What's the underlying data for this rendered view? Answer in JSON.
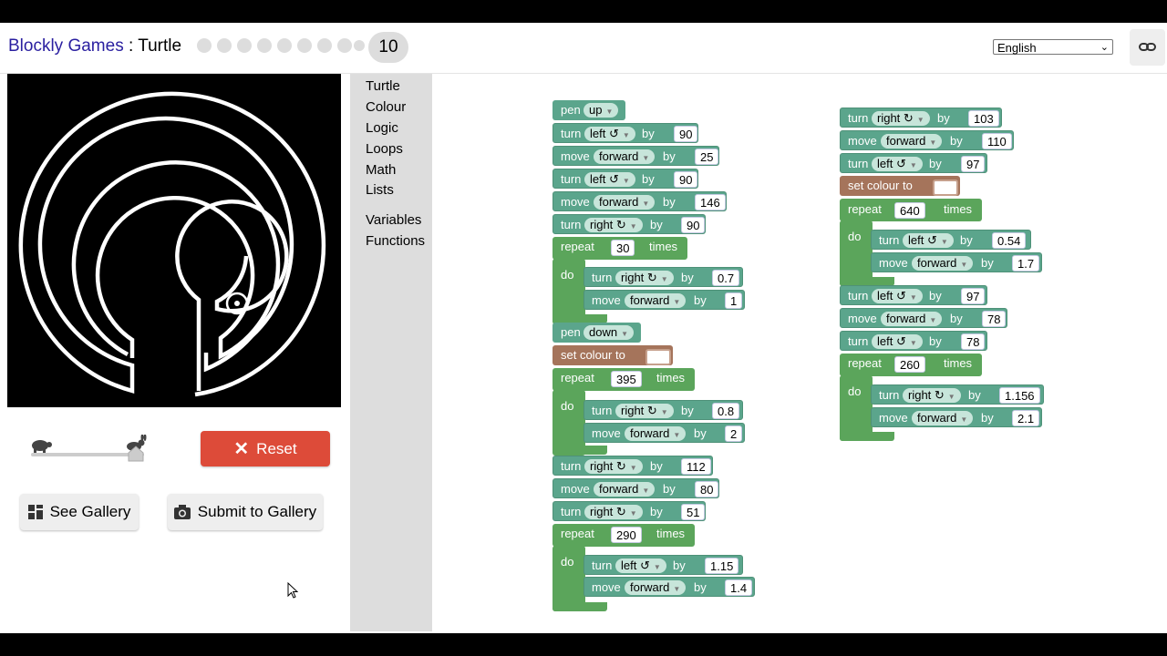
{
  "header": {
    "app_name": "Blockly Games",
    "separator": " : ",
    "game_name": "Turtle",
    "levels": [
      1,
      2,
      3,
      4,
      5,
      6,
      7,
      8,
      9
    ],
    "current_level": "10",
    "language": "English"
  },
  "controls": {
    "reset_label": "Reset",
    "see_gallery_label": "See Gallery",
    "submit_gallery_label": "Submit to Gallery"
  },
  "toolbox": {
    "categories": [
      "Turtle",
      "Colour",
      "Logic",
      "Loops",
      "Math",
      "Lists"
    ],
    "categories2": [
      "Variables",
      "Functions"
    ]
  },
  "words": {
    "pen": "pen",
    "turn": "turn",
    "by": "by",
    "move": "move",
    "repeat": "repeat",
    "times": "times",
    "do": "do",
    "set_colour": "set colour to"
  },
  "program_left": {
    "b1": {
      "state": "up"
    },
    "b2": {
      "dir": "left ↺",
      "val": "90"
    },
    "b3": {
      "dir": "forward",
      "val": "25"
    },
    "b4": {
      "dir": "left ↺",
      "val": "90"
    },
    "b5": {
      "dir": "forward",
      "val": "146"
    },
    "b6": {
      "dir": "right ↻",
      "val": "90"
    },
    "r1": {
      "count": "30",
      "turn_dir": "right ↻",
      "turn_val": "0.7",
      "move_dir": "forward",
      "move_val": "1"
    },
    "b7": {
      "state": "down"
    },
    "r2": {
      "count": "395",
      "turn_dir": "right ↻",
      "turn_val": "0.8",
      "move_dir": "forward",
      "move_val": "2"
    },
    "b9": {
      "dir": "right ↻",
      "val": "112"
    },
    "b10": {
      "dir": "forward",
      "val": "80"
    },
    "b11": {
      "dir": "right ↻",
      "val": "51"
    },
    "r3": {
      "count": "290",
      "turn_dir": "left ↺",
      "turn_val": "1.15",
      "move_dir": "forward",
      "move_val": "1.4"
    }
  },
  "program_right": {
    "b1": {
      "dir": "right ↻",
      "val": "103"
    },
    "b2": {
      "dir": "forward",
      "val": "110"
    },
    "b3": {
      "dir": "left ↺",
      "val": "97"
    },
    "r1": {
      "count": "640",
      "turn_dir": "left ↺",
      "turn_val": "0.54",
      "move_dir": "forward",
      "move_val": "1.7"
    },
    "b5": {
      "dir": "left ↺",
      "val": "97"
    },
    "b6": {
      "dir": "forward",
      "val": "78"
    },
    "b7": {
      "dir": "left ↺",
      "val": "78"
    },
    "r2": {
      "count": "260",
      "turn_dir": "right ↻",
      "turn_val": "1.156",
      "move_dir": "forward",
      "move_val": "2.1"
    }
  }
}
